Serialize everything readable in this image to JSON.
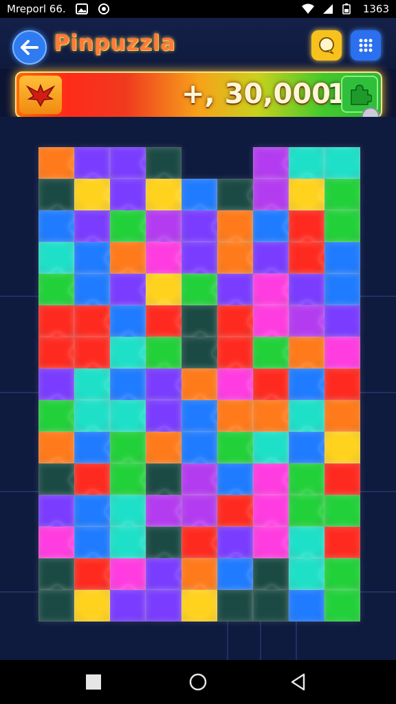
{
  "status_bar": {
    "left_text": "Mreporl 66.",
    "right_text": "1363",
    "icons": [
      "image-icon",
      "record-icon",
      "wifi-icon",
      "signal-icon",
      "battery-icon"
    ]
  },
  "header": {
    "title": "Pinpuzzla",
    "back_icon": "arrow-left-icon",
    "chat_icon": "chat-bubble-icon",
    "menu_icon": "grid-menu-icon"
  },
  "score_bar": {
    "emblem_icon": "phoenix-emblem-icon",
    "score": "+, 30,000",
    "count": "1",
    "piece_icon": "puzzle-piece-icon",
    "badge_icon": "gear-badge-icon"
  },
  "board": {
    "palette": {
      "red": "#ff2a1f",
      "orange": "#ff7a1a",
      "yellow": "#ffd21e",
      "green": "#22d13a",
      "teal": "#1ee0c8",
      "blue": "#1f7bff",
      "violet": "#7a3cff",
      "purple": "#b43cf0",
      "magenta": "#ff3ce0",
      "dark": "#1b4a44"
    },
    "pieces": [
      [
        "orange",
        "violet",
        "violet",
        "dark",
        null,
        null,
        "purple",
        "teal",
        "teal"
      ],
      [
        "dark",
        "yellow",
        "violet",
        "yellow",
        "blue",
        "dark",
        "purple",
        "yellow",
        "green"
      ],
      [
        "blue",
        "violet",
        "green",
        "purple",
        "violet",
        "orange",
        "blue",
        "red",
        "green"
      ],
      [
        "teal",
        "blue",
        "orange",
        "magenta",
        "violet",
        "orange",
        "violet",
        "red",
        "blue"
      ],
      [
        "green",
        "blue",
        "violet",
        "yellow",
        "green",
        "violet",
        "magenta",
        "violet",
        "blue"
      ],
      [
        "red",
        "red",
        "blue",
        "red",
        "dark",
        "red",
        "magenta",
        "purple",
        "violet"
      ],
      [
        "red",
        "red",
        "teal",
        "green",
        "dark",
        "red",
        "green",
        "orange",
        "magenta"
      ],
      [
        "violet",
        "teal",
        "blue",
        "violet",
        "orange",
        "magenta",
        "red",
        "blue",
        "red"
      ],
      [
        "green",
        "teal",
        "teal",
        "violet",
        "blue",
        "orange",
        "orange",
        "teal",
        "orange"
      ],
      [
        "orange",
        "blue",
        "green",
        "orange",
        "blue",
        "green",
        "teal",
        "blue",
        "yellow"
      ],
      [
        "dark",
        "red",
        "green",
        "dark",
        "purple",
        "blue",
        "magenta",
        "green",
        "red"
      ],
      [
        "violet",
        "blue",
        "teal",
        "purple",
        "purple",
        "red",
        "magenta",
        "green",
        "green"
      ],
      [
        "magenta",
        "blue",
        "teal",
        "dark",
        "red",
        "violet",
        "magenta",
        "teal",
        "red"
      ],
      [
        "dark",
        "red",
        "magenta",
        "violet",
        "orange",
        "blue",
        "dark",
        "teal",
        "green"
      ],
      [
        "dark",
        "yellow",
        "violet",
        "violet",
        "yellow",
        "dark",
        "dark",
        "blue",
        "green"
      ]
    ]
  },
  "nav_bar": {
    "recents_icon": "square-recents-icon",
    "home_icon": "circle-home-icon",
    "back_icon": "triangle-back-icon"
  }
}
